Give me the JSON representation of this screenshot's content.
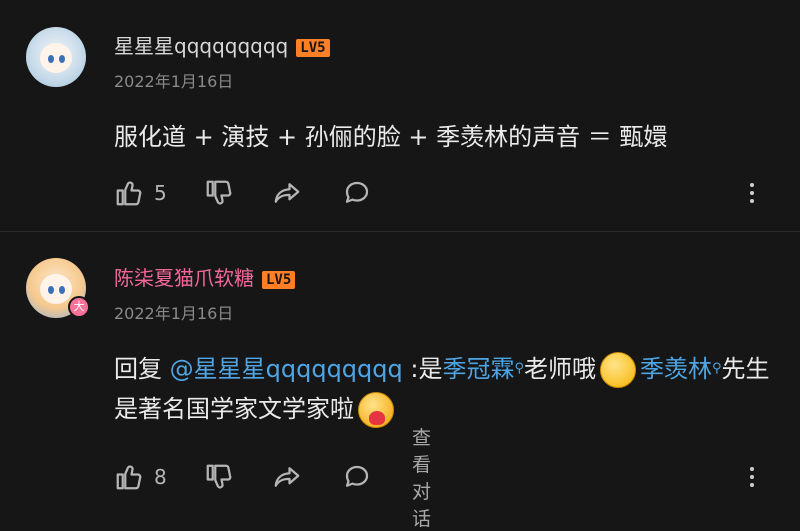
{
  "comments": [
    {
      "username": "星星星qqqqqqqqq",
      "level": "LV5",
      "date": "2022年1月16日",
      "content": "服化道 + 演技 + 孙俪的脸 + 季羡林的声音 ＝ 甄嬛",
      "likes": "5"
    },
    {
      "username": "陈柒夏猫爪软糖",
      "level": "LV5",
      "badge": "大",
      "date": "2022年1月16日",
      "content": {
        "prefix": "回复 ",
        "mention": "@星星星qqqqqqqqq",
        "text1": " :是",
        "kw1": "季冠霖",
        "text2": "老师哦",
        "kw2": "季羡林",
        "text3": "先生是著名国学家文学家啦"
      },
      "likes": "8",
      "view_dialog": "查看对话"
    }
  ],
  "icons": [
    "thumbs-up-icon",
    "thumbs-down-icon",
    "share-icon",
    "reply-icon",
    "more-vertical-icon",
    "search-icon",
    "smile-emoji",
    "hug-emoji"
  ],
  "colors": {
    "background": "#161616",
    "username_vip": "#f2679a",
    "level_badge": "#ff7f24",
    "link": "#4ea5e6"
  }
}
